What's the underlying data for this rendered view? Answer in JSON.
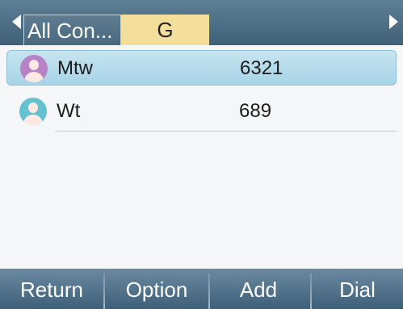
{
  "header": {
    "tabs": [
      {
        "label": "All Con..."
      },
      {
        "label": "G"
      }
    ]
  },
  "contacts": [
    {
      "name": "Mtw",
      "number": "6321"
    },
    {
      "name": "Wt",
      "number": "689"
    }
  ],
  "softkeys": {
    "return_label": "Return",
    "option_label": "Option",
    "add_label": "Add",
    "dial_label": "Dial"
  },
  "colors": {
    "header": "#4a6a82",
    "selected_tab": "#f4df9a",
    "selected_row": "#b5dbe9",
    "avatar_pink": "#b783c6",
    "avatar_teal": "#64c1cf"
  },
  "icons": {
    "left": "arrow-left-icon",
    "right": "arrow-right-icon",
    "avatar": "person-avatar-icon"
  }
}
